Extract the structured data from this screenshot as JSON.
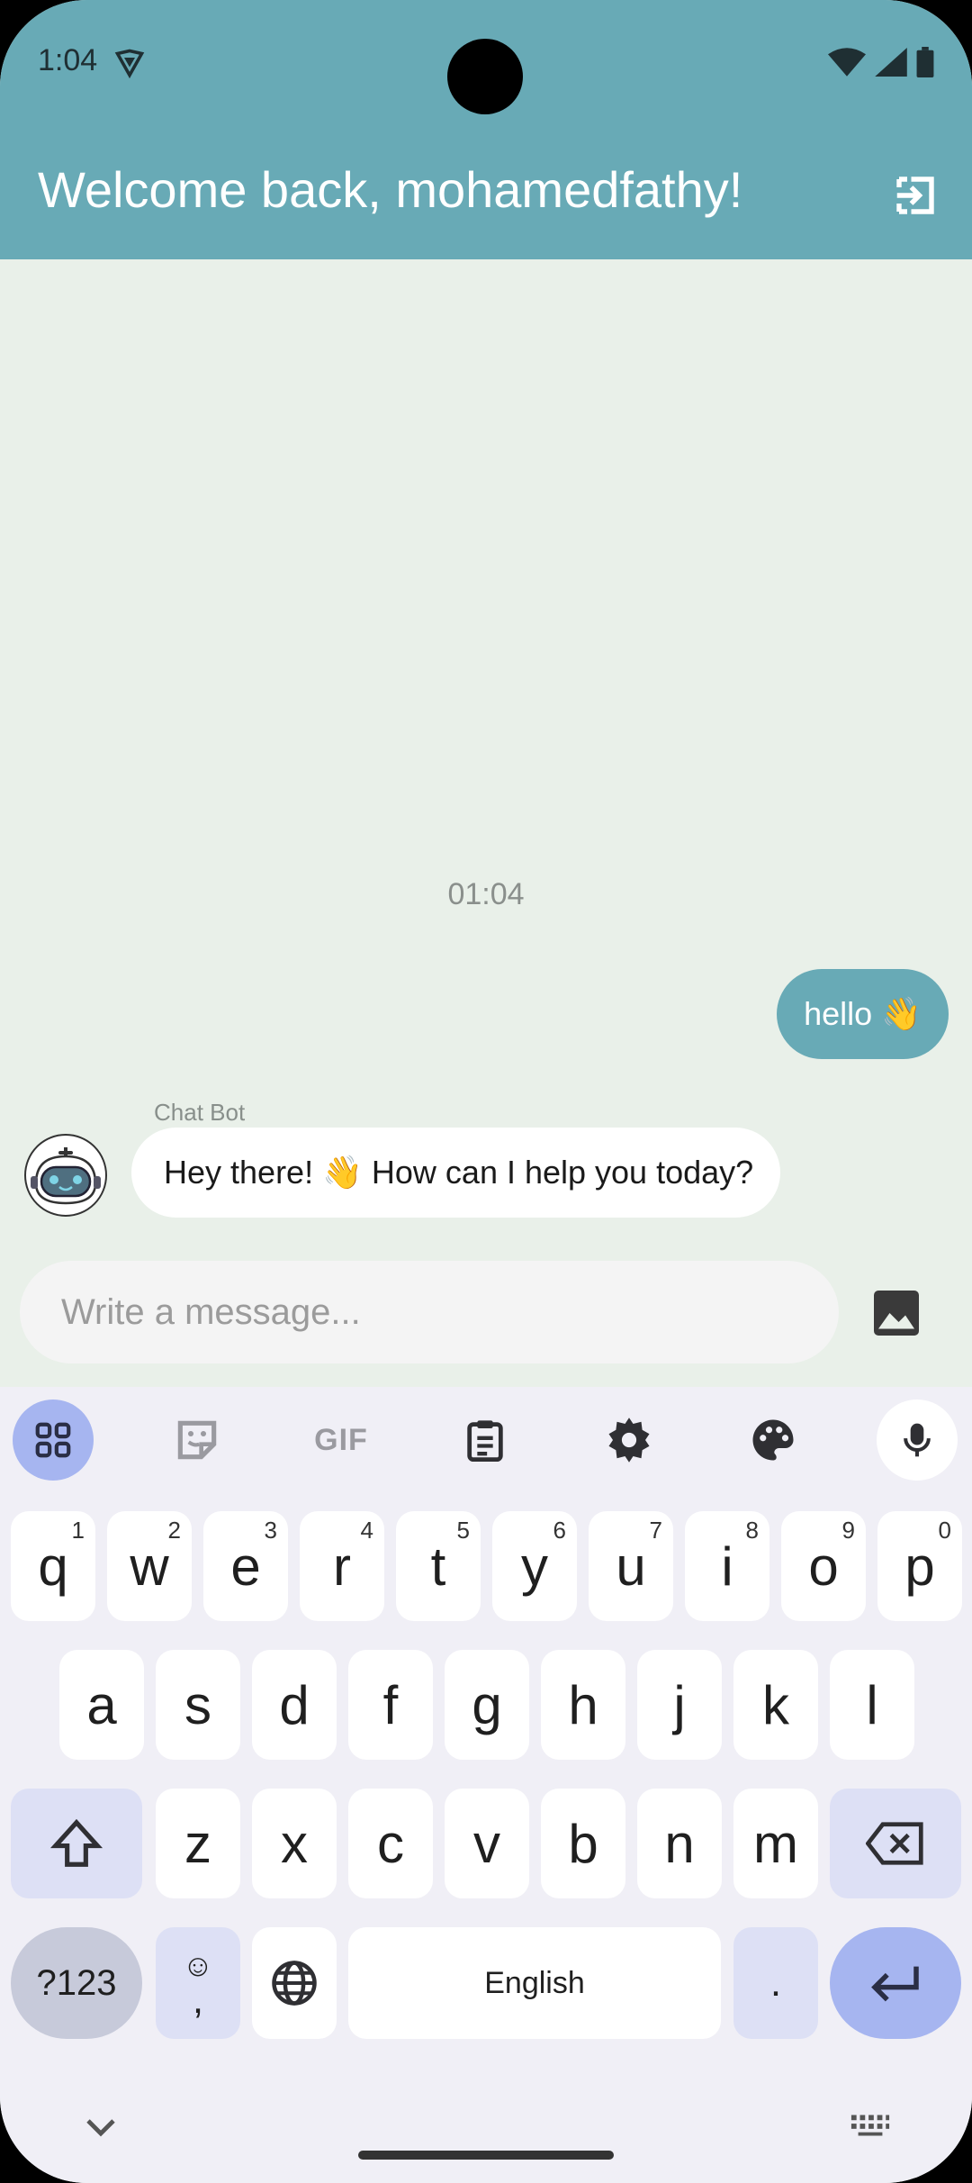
{
  "status_bar": {
    "time": "1:04"
  },
  "header": {
    "title": "Welcome back, mohamedfathy!",
    "logout_icon": "logout-icon"
  },
  "chat": {
    "timestamp": "01:04",
    "messages": [
      {
        "sender": "user",
        "text": "hello 👋"
      },
      {
        "sender": "Chat Bot",
        "text": "Hey there! 👋 How can I help you today?"
      }
    ]
  },
  "composer": {
    "placeholder": "Write a message...",
    "image_icon": "image-icon"
  },
  "keyboard": {
    "toolbar": [
      "apps-icon",
      "sticker-icon",
      "GIF",
      "clipboard-icon",
      "settings-icon",
      "palette-icon",
      "mic-icon"
    ],
    "row1": [
      {
        "k": "q",
        "n": "1"
      },
      {
        "k": "w",
        "n": "2"
      },
      {
        "k": "e",
        "n": "3"
      },
      {
        "k": "r",
        "n": "4"
      },
      {
        "k": "t",
        "n": "5"
      },
      {
        "k": "y",
        "n": "6"
      },
      {
        "k": "u",
        "n": "7"
      },
      {
        "k": "i",
        "n": "8"
      },
      {
        "k": "o",
        "n": "9"
      },
      {
        "k": "p",
        "n": "0"
      }
    ],
    "row2": [
      "a",
      "s",
      "d",
      "f",
      "g",
      "h",
      "j",
      "k",
      "l"
    ],
    "row3": [
      "z",
      "x",
      "c",
      "v",
      "b",
      "n",
      "m"
    ],
    "symbols_key": "?123",
    "emoji_key_top": "☺",
    "emoji_key_bottom": ",",
    "space_label": "English",
    "period_key": ".",
    "colors": {
      "header": "#68aab6",
      "accent_key": "#a6b5f0"
    }
  }
}
